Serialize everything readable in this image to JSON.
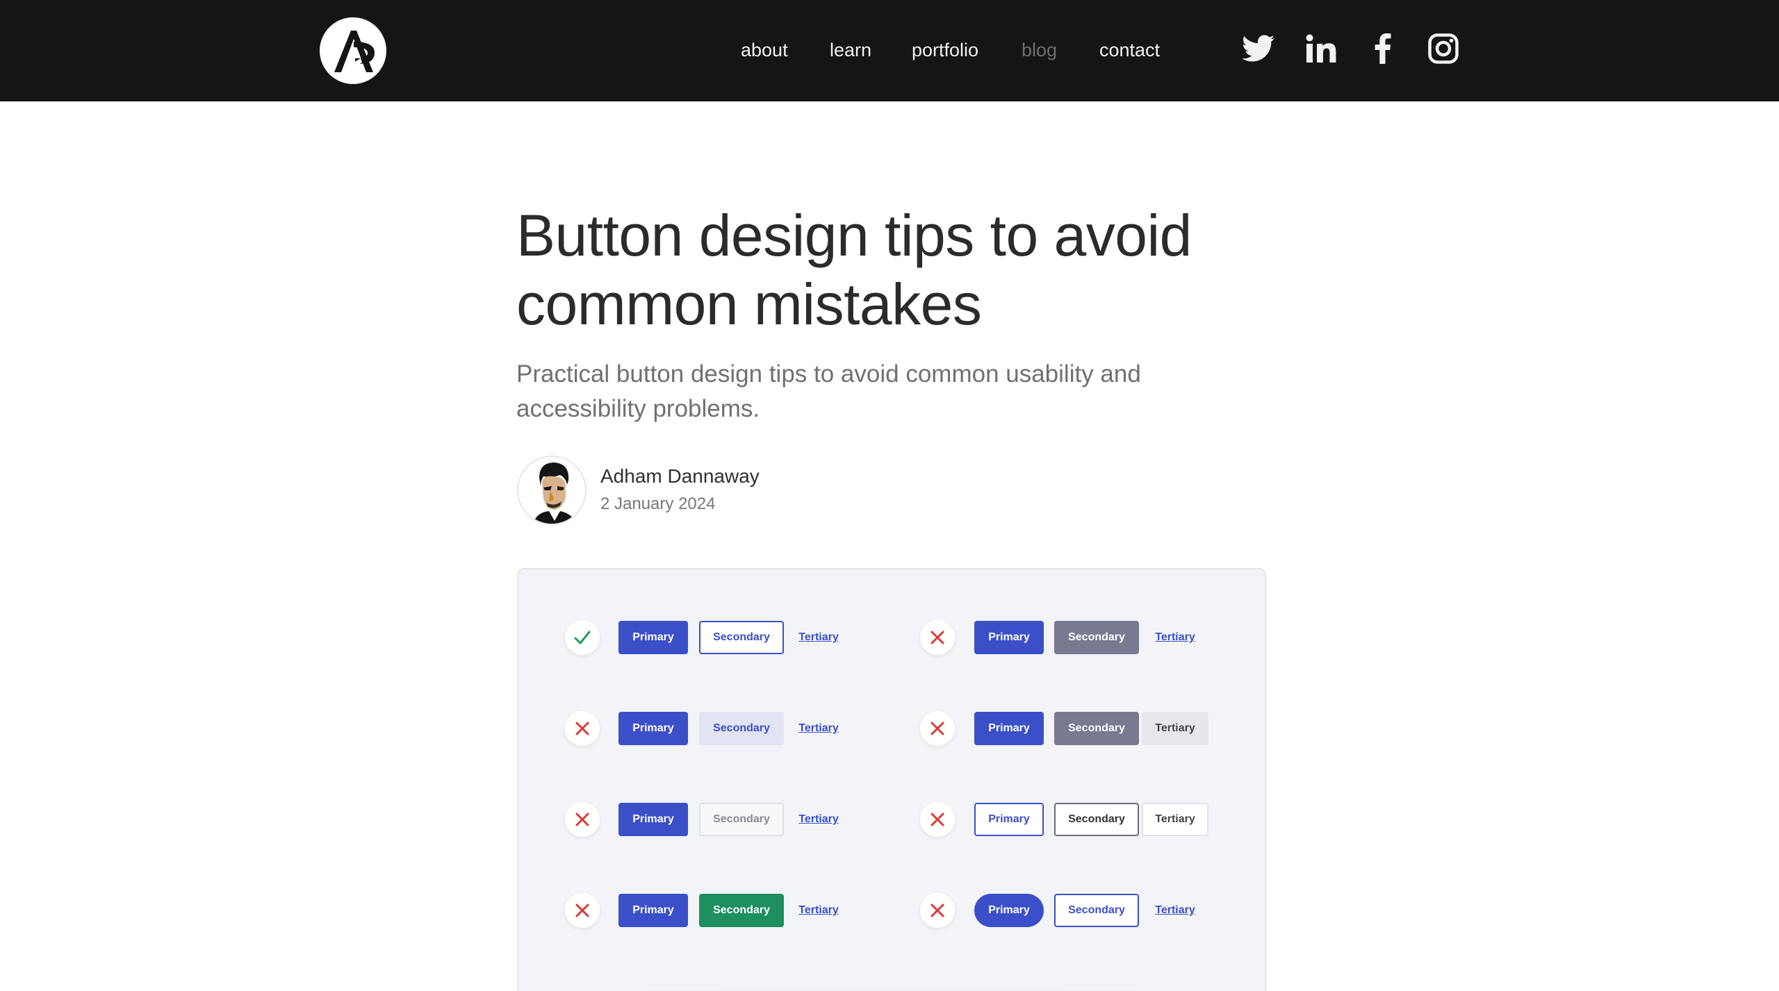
{
  "nav": {
    "items": [
      {
        "label": "about",
        "muted": false
      },
      {
        "label": "learn",
        "muted": false
      },
      {
        "label": "portfolio",
        "muted": false
      },
      {
        "label": "blog",
        "muted": true
      },
      {
        "label": "contact",
        "muted": false
      }
    ],
    "social": [
      "twitter-icon",
      "linkedin-icon",
      "facebook-icon",
      "instagram-icon"
    ]
  },
  "article": {
    "title_line1": "Button design tips to avoid",
    "title_line2": "common mistakes",
    "subtitle_line1": "Practical button design tips to avoid common usability and",
    "subtitle_line2": "accessibility problems.",
    "author": "Adham Dannaway",
    "date": "2 January 2024"
  },
  "illustration": {
    "rows": [
      {
        "left_ok": true,
        "left": [
          "Primary",
          "Secondary",
          "Tertiary"
        ],
        "right_ok": false,
        "right": [
          "Primary",
          "Secondary",
          "Tertiary"
        ]
      },
      {
        "left_ok": false,
        "left": [
          "Primary",
          "Secondary",
          "Tertiary"
        ],
        "right_ok": false,
        "right": [
          "Primary",
          "Secondary",
          "Tertiary"
        ]
      },
      {
        "left_ok": false,
        "left": [
          "Primary",
          "Secondary",
          "Tertiary"
        ],
        "right_ok": false,
        "right": [
          "Primary",
          "Secondary",
          "Tertiary"
        ]
      },
      {
        "left_ok": false,
        "left": [
          "Primary",
          "Secondary",
          "Tertiary"
        ],
        "right_ok": false,
        "right": [
          "Primary",
          "Secondary",
          "Tertiary"
        ]
      }
    ]
  },
  "colors": {
    "header_bg": "#151515",
    "brand_blue": "#3b4fc9",
    "check_green": "#1e9e5a",
    "cross_red": "#d93a3a"
  }
}
